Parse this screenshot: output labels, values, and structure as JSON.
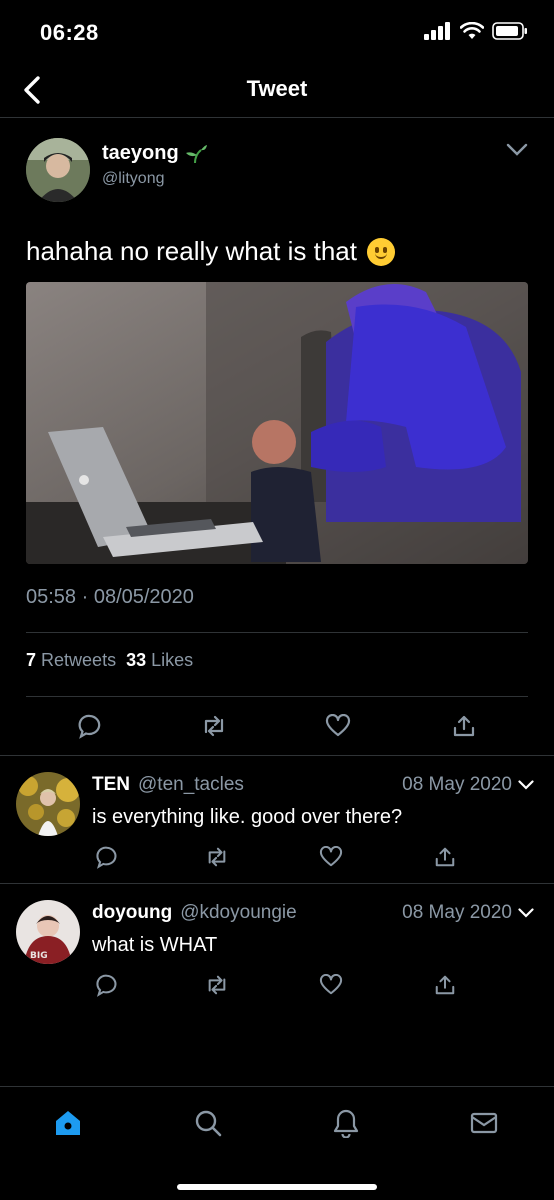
{
  "status_bar": {
    "time": "06:28"
  },
  "nav": {
    "title": "Tweet"
  },
  "tweet": {
    "author_name": "taeyong",
    "author_handle": "@lityong",
    "text": "hahaha no really what is that",
    "timestamp": "05:58 · 08/05/2020",
    "retweets_count": "7",
    "retweets_label": "Retweets",
    "likes_count": "33",
    "likes_label": "Likes"
  },
  "replies": [
    {
      "name": "TEN",
      "handle": "@ten_tacles",
      "date": "08 May 2020",
      "text": "is everything like. good over there?"
    },
    {
      "name": "doyoung",
      "handle": "@kdoyoungie",
      "date": "08 May 2020",
      "text": "what is WHAT"
    }
  ],
  "icons": {
    "back": "chevron-left",
    "caret": "chevron-down",
    "reply": "speech-bubble",
    "retweet": "retweet-arrows",
    "like": "heart",
    "share": "share-up-arrow",
    "home": "home",
    "search": "magnifier",
    "notifications": "bell",
    "messages": "envelope"
  },
  "colors": {
    "background": "#000000",
    "accent": "#1d9bf0",
    "secondary_text": "#8b98a5",
    "divider": "#2f3336"
  }
}
